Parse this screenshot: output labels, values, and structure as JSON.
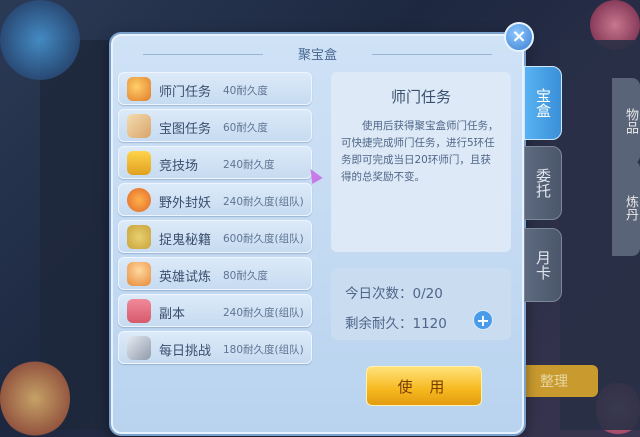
{
  "dialog": {
    "title": "聚宝盒"
  },
  "tasks": [
    {
      "name": "师门任务",
      "cost": "40耐久度",
      "icon": "scroll-seal-icon",
      "color": "#e07b2a"
    },
    {
      "name": "宝图任务",
      "cost": "60耐久度",
      "icon": "treasure-map-icon",
      "color": "#d9a46a"
    },
    {
      "name": "竞技场",
      "cost": "240耐久度",
      "icon": "arena-banner-icon",
      "color": "#e0a020"
    },
    {
      "name": "野外封妖",
      "cost": "240耐久度(组队)",
      "icon": "demon-face-icon",
      "color": "#e0682a"
    },
    {
      "name": "捉鬼秘籍",
      "cost": "600耐久度(组队)",
      "icon": "ghost-book-icon",
      "color": "#c9a23a"
    },
    {
      "name": "英雄试炼",
      "cost": "80耐久度",
      "icon": "hero-icon",
      "color": "#e88a3a"
    },
    {
      "name": "副本",
      "cost": "240耐久度(组队)",
      "icon": "dungeon-gate-icon",
      "color": "#d65a6a"
    },
    {
      "name": "每日挑战",
      "cost": "180耐久度(组队)",
      "icon": "daily-challenge-icon",
      "color": "#aab4c4"
    }
  ],
  "detail": {
    "title": "师门任务",
    "text": "使用后获得聚宝盒师门任务，可快捷完成师门任务，进行5环任务即可完成当日20环师门，且获得的总奖励不变。"
  },
  "stats": {
    "today_label": "今日次数：0/20",
    "durability_label": "剩余耐久：1120"
  },
  "buttons": {
    "use": "使 用",
    "close": "×",
    "plus": "+"
  },
  "tabs": [
    {
      "label": "宝盒",
      "active": true
    },
    {
      "label": "委托",
      "active": false
    },
    {
      "label": "月卡",
      "active": false
    }
  ],
  "background": {
    "right_tabs": [
      "物品",
      "炼丹"
    ],
    "sort_button": "整理"
  }
}
